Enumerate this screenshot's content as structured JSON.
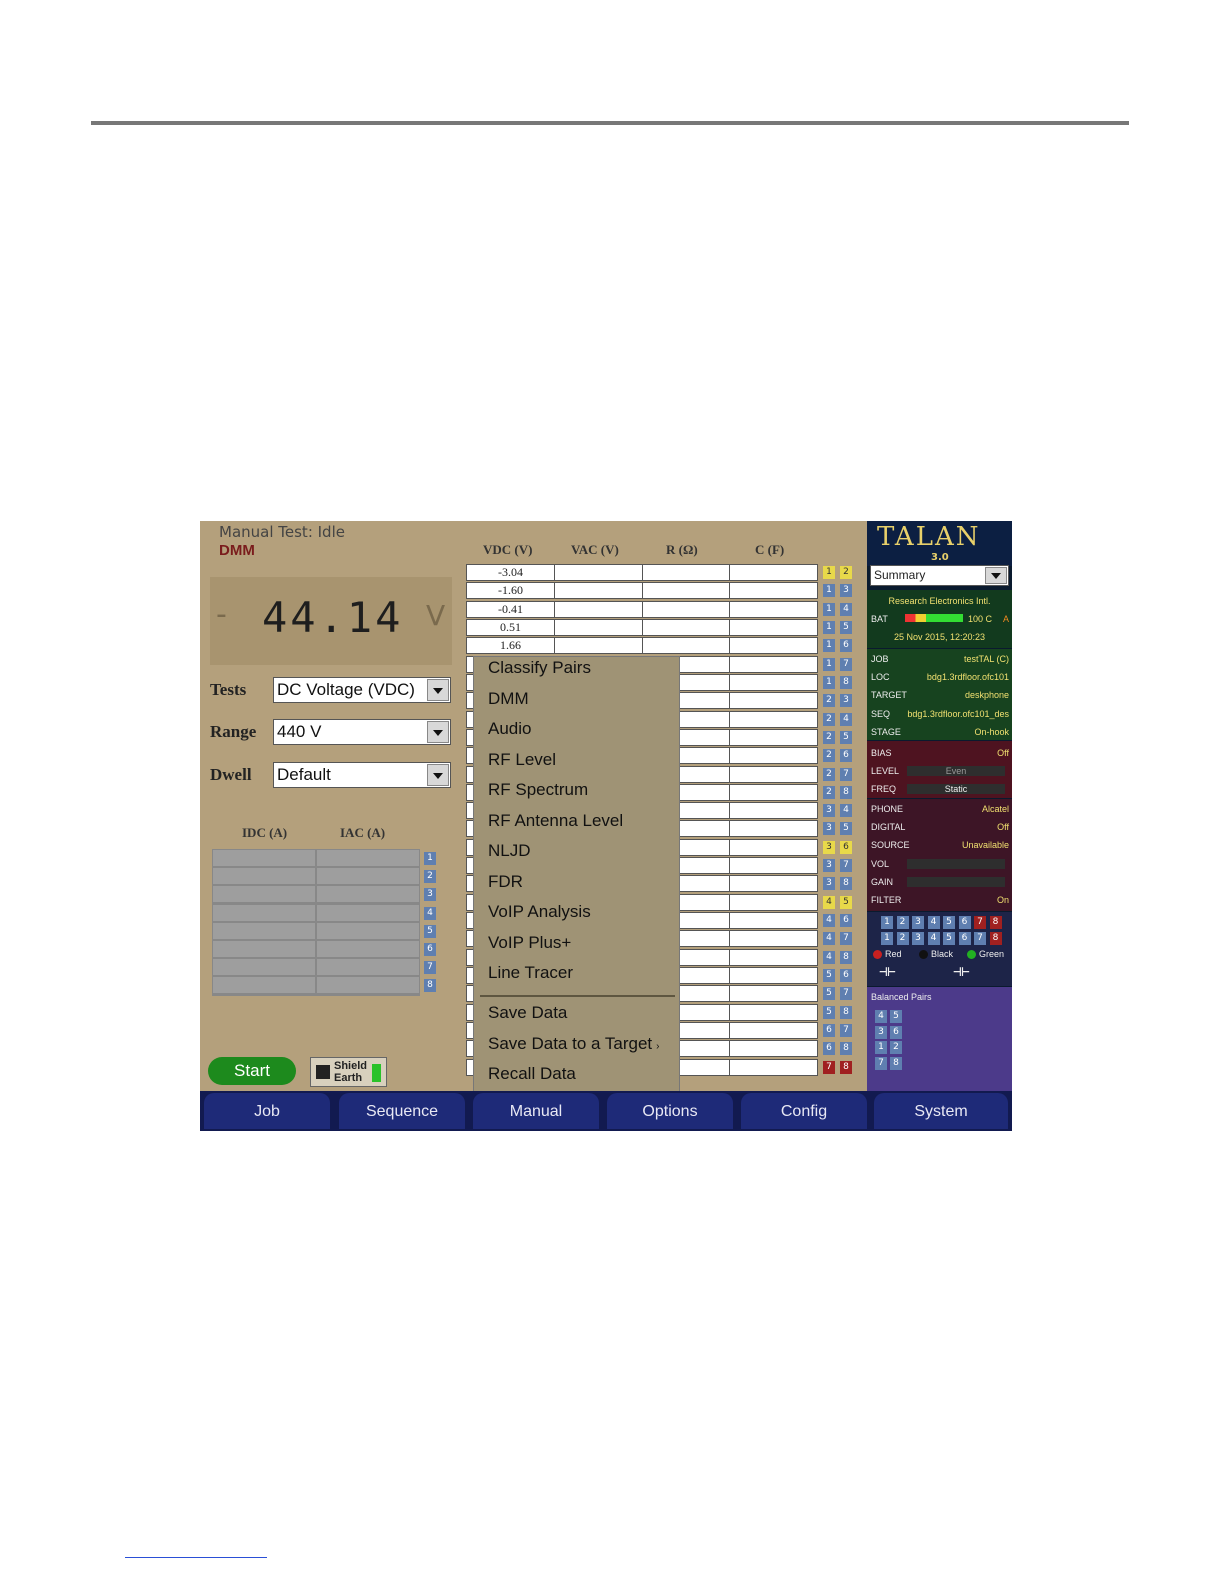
{
  "app": {
    "status": "Manual Test: Idle",
    "mode": "DMM",
    "readout": {
      "sign": "-",
      "value": "44.14",
      "unit": "V"
    },
    "controls": [
      {
        "label": "Tests",
        "value": "DC Voltage (VDC)"
      },
      {
        "label": "Range",
        "value": "440 V"
      },
      {
        "label": "Dwell",
        "value": "Default"
      }
    ],
    "current_headers": [
      "IDC (A)",
      "IAC (A)"
    ],
    "current_channels": [
      "1",
      "2",
      "3",
      "4",
      "5",
      "6",
      "7",
      "8"
    ],
    "start_label": "Start",
    "shield_label_1": "Shield",
    "shield_label_2": "Earth",
    "measure_headers": [
      "VDC (V)",
      "VAC (V)",
      "R (Ω)",
      "C (F)"
    ],
    "vdc_values": [
      "-3.04",
      "-1.60",
      "-0.41",
      "0.51",
      "1.66"
    ],
    "pairs": [
      [
        "1",
        "2",
        "y"
      ],
      [
        "1",
        "3",
        ""
      ],
      [
        "1",
        "4",
        ""
      ],
      [
        "1",
        "5",
        ""
      ],
      [
        "1",
        "6",
        ""
      ],
      [
        "1",
        "7",
        ""
      ],
      [
        "1",
        "8",
        ""
      ],
      [
        "2",
        "3",
        ""
      ],
      [
        "2",
        "4",
        ""
      ],
      [
        "2",
        "5",
        ""
      ],
      [
        "2",
        "6",
        ""
      ],
      [
        "2",
        "7",
        ""
      ],
      [
        "2",
        "8",
        ""
      ],
      [
        "3",
        "4",
        ""
      ],
      [
        "3",
        "5",
        ""
      ],
      [
        "3",
        "6",
        "y"
      ],
      [
        "3",
        "7",
        ""
      ],
      [
        "3",
        "8",
        ""
      ],
      [
        "4",
        "5",
        "y"
      ],
      [
        "4",
        "6",
        ""
      ],
      [
        "4",
        "7",
        ""
      ],
      [
        "4",
        "8",
        ""
      ],
      [
        "5",
        "6",
        ""
      ],
      [
        "5",
        "7",
        ""
      ],
      [
        "5",
        "8",
        ""
      ],
      [
        "6",
        "7",
        ""
      ],
      [
        "6",
        "8",
        ""
      ],
      [
        "7",
        "8",
        "r"
      ]
    ],
    "menu": {
      "items": [
        "Classify Pairs",
        "DMM",
        "Audio",
        "RF Level",
        "RF Spectrum",
        "RF Antenna Level",
        "NLJD",
        "FDR",
        "VoIP Analysis",
        "VoIP Plus+",
        "Line Tracer"
      ],
      "items_after": [
        "Save Data",
        "Save Data to a Target",
        "Recall Data"
      ],
      "submenu_arrow": "›"
    },
    "nav": [
      "Job",
      "Sequence",
      "Manual",
      "Options",
      "Config",
      "System"
    ]
  },
  "sidebar": {
    "logo": "TALAN",
    "version": "3.0",
    "view": "Summary",
    "company": "Research Electronics Intl.",
    "bat_label": "BAT",
    "bat_value": "100 C",
    "bat_flag": "A",
    "datetime": "25 Nov 2015, 12:20:23",
    "job_rows": [
      {
        "key": "JOB",
        "value": "testTAL (C)"
      },
      {
        "key": "LOC",
        "value": "bdg1.3rdfloor.ofc101"
      },
      {
        "key": "TARGET",
        "value": "deskphone"
      },
      {
        "key": "SEQ",
        "value": "bdg1.3rdfloor.ofc101_des"
      },
      {
        "key": "STAGE",
        "value": "On-hook"
      }
    ],
    "bias_label": "BIAS",
    "bias_value": "Off",
    "level_label": "LEVEL",
    "level_value": "Even",
    "freq_label": "FREQ",
    "freq_value": "Static",
    "phone_rows": [
      {
        "key": "PHONE",
        "value": "Alcatel"
      },
      {
        "key": "DIGITAL",
        "value": "Off"
      },
      {
        "key": "SOURCE",
        "value": "Unavailable"
      }
    ],
    "vol_label": "VOL",
    "gain_label": "GAIN",
    "filter_label": "FILTER",
    "filter_value": "On",
    "line_nums": [
      "1",
      "2",
      "3",
      "4",
      "5",
      "6",
      "7",
      "8"
    ],
    "legend": [
      "Red",
      "Black",
      "Green"
    ],
    "cap_symbol": "⊣⊢",
    "balanced_title": "Balanced Pairs",
    "balanced_pairs": [
      [
        "4",
        "5"
      ],
      [
        "3",
        "6"
      ],
      [
        "1",
        "2"
      ],
      [
        "7",
        "8"
      ]
    ],
    "colors": {
      "red": "#c82020",
      "black": "#111111",
      "green": "#22b022"
    }
  }
}
